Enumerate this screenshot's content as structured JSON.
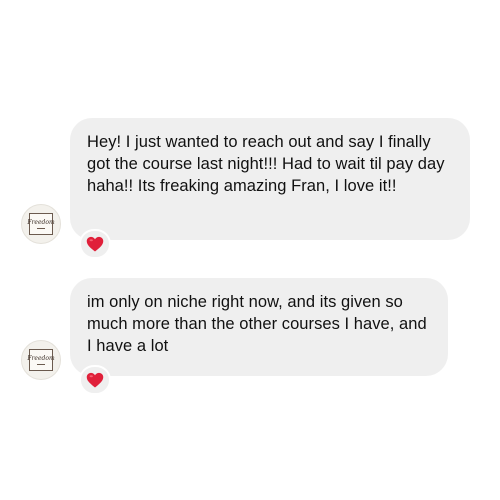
{
  "messages": [
    {
      "text": "Hey! I just wanted to reach out and say I finally got the course last night!!! Had to wait til pay day haha!! Its freaking amazing Fran, I love it!!",
      "reaction": "red-heart",
      "reaction_color": "#e0203a"
    },
    {
      "text": "im only on niche right now, and its given so much more than the other courses I have, and I have a lot",
      "reaction": "red-heart",
      "reaction_color": "#e0203a"
    }
  ],
  "avatar": {
    "logo_text": "Freedom",
    "icon": "brand-logo-icon"
  },
  "colors": {
    "bubble_bg": "#efefef",
    "text": "#111111",
    "background": "#ffffff"
  }
}
